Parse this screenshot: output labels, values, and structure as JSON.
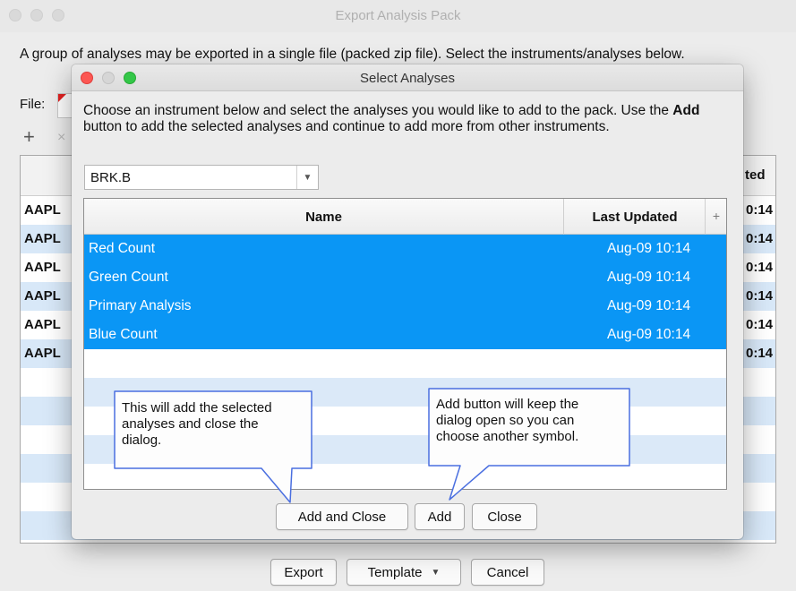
{
  "outer": {
    "title": "Export Analysis Pack",
    "description": "A group of analyses may be exported in a single file (packed zip file). Select the instruments/analyses below.",
    "file_label": "File:",
    "add_icon_glyph": "+",
    "remove_icon_glyph": "×",
    "table_header_updated": "ted",
    "table_header_plus": "+",
    "rows": [
      {
        "symbol": "AAPL",
        "time": "0:14"
      },
      {
        "symbol": "AAPL",
        "time": "0:14"
      },
      {
        "symbol": "AAPL",
        "time": "0:14"
      },
      {
        "symbol": "AAPL",
        "time": "0:14"
      },
      {
        "symbol": "AAPL",
        "time": "0:14"
      },
      {
        "symbol": "AAPL",
        "time": "0:14"
      }
    ],
    "buttons": {
      "export": "Export",
      "template": "Template",
      "cancel": "Cancel"
    }
  },
  "dialog": {
    "title": "Select Analyses",
    "desc_part1": "Choose an instrument below and select the analyses you would like to add to the pack.  Use the ",
    "desc_bold": "Add",
    "desc_part2": " button to add the selected analyses and continue to add more from other instruments.",
    "instrument": "BRK.B",
    "columns": {
      "name": "Name",
      "last_updated": "Last Updated",
      "plus": "+"
    },
    "rows": [
      {
        "name": "Red Count",
        "updated": "Aug-09 10:14"
      },
      {
        "name": "Green Count",
        "updated": "Aug-09 10:14"
      },
      {
        "name": "Primary Analysis",
        "updated": "Aug-09 10:14"
      },
      {
        "name": "Blue Count",
        "updated": "Aug-09 10:14"
      }
    ],
    "buttons": {
      "add_and_close": "Add and Close",
      "add": "Add",
      "close": "Close"
    }
  },
  "callouts": {
    "left": [
      "This will add the selected",
      "analyses and close the",
      "dialog."
    ],
    "right": [
      "Add button will keep the",
      "dialog open so you can",
      "choose another symbol."
    ]
  },
  "colors": {
    "selection": "#0a96f5",
    "alt_row": "#dbe9f8",
    "callout_border": "#4a6fe0"
  }
}
